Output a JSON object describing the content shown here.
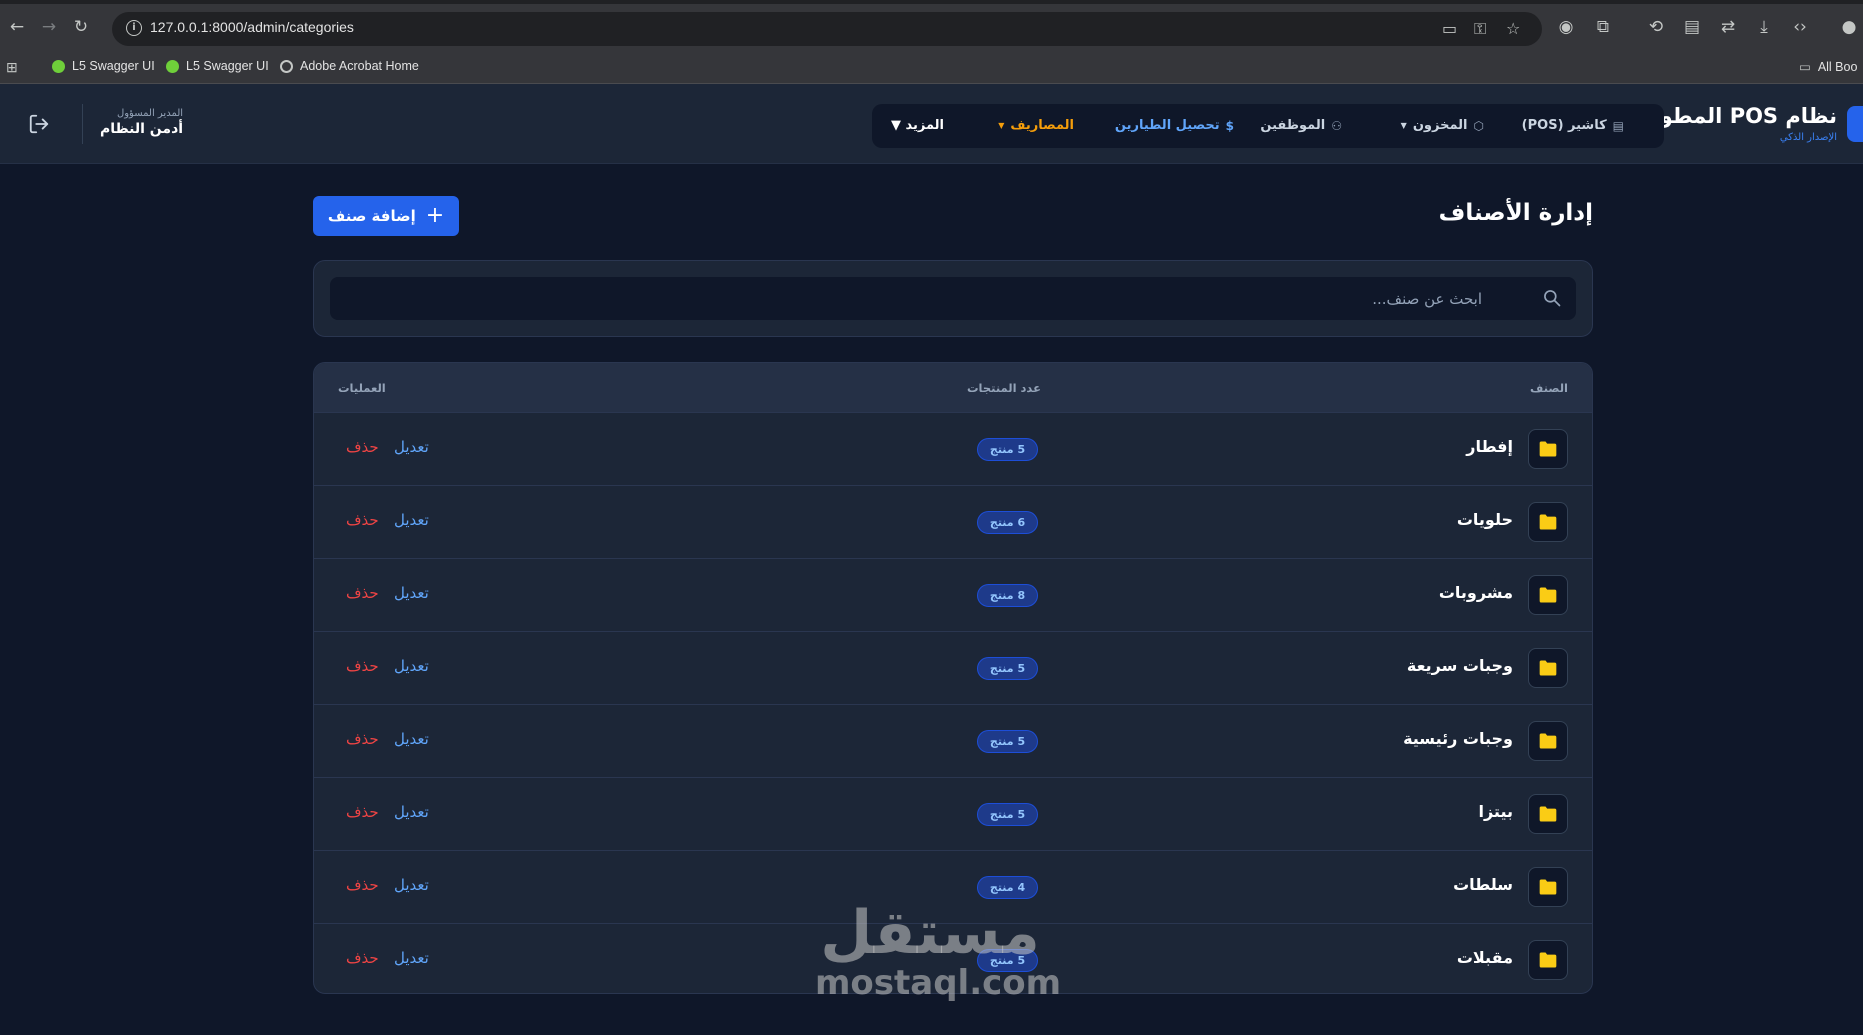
{
  "browser": {
    "url": "127.0.0.1:8000/admin/categories",
    "bookmarks": [
      "L5 Swagger UI",
      "L5 Swagger UI",
      "Adobe Acrobat Home"
    ],
    "all_bookmarks": "All Boo"
  },
  "header": {
    "brand_title": "نظام POS المطور",
    "brand_subtitle": "الإصدار الذكي",
    "nav": [
      {
        "label": "كاشير (POS)",
        "icon": "calculator-icon"
      },
      {
        "label": "المخزون",
        "icon": "box-icon"
      },
      {
        "label": "الموظفين",
        "icon": "users-icon"
      },
      {
        "label": "تحصيل الطيارين",
        "icon": "dollar-icon"
      },
      {
        "label": "المصاريف",
        "icon": "caret-icon"
      },
      {
        "label": "المزيد ▼",
        "icon": ""
      }
    ],
    "user_role": "المدير المسؤول",
    "user_name": "أدمن النظام"
  },
  "page": {
    "title": "إدارة الأصناف",
    "add_button": "إضافة صنف",
    "search_placeholder": "ابحث عن صنف..."
  },
  "table": {
    "headers": {
      "category": "الصنف",
      "count": "عدد المنتجات",
      "actions": "العمليات"
    },
    "edit_label": "تعديل",
    "delete_label": "حذف",
    "rows": [
      {
        "name": "إفطار",
        "count": "5 منتج"
      },
      {
        "name": "حلويات",
        "count": "6 منتج"
      },
      {
        "name": "مشروبات",
        "count": "8 منتج"
      },
      {
        "name": "وجبات سريعة",
        "count": "5 منتج"
      },
      {
        "name": "وجبات رئيسية",
        "count": "5 منتج"
      },
      {
        "name": "بيتزا",
        "count": "5 منتج"
      },
      {
        "name": "سلطات",
        "count": "4 منتج"
      },
      {
        "name": "مقبلات",
        "count": "5 منتج"
      }
    ]
  },
  "watermark": {
    "arabic": "مستقل",
    "latin": "mostaql.com"
  },
  "colors": {
    "accent": "#2563eb",
    "folder": "#facc15",
    "danger": "#ef4444",
    "link": "#60a5fa",
    "expenses": "#f59e0b"
  }
}
